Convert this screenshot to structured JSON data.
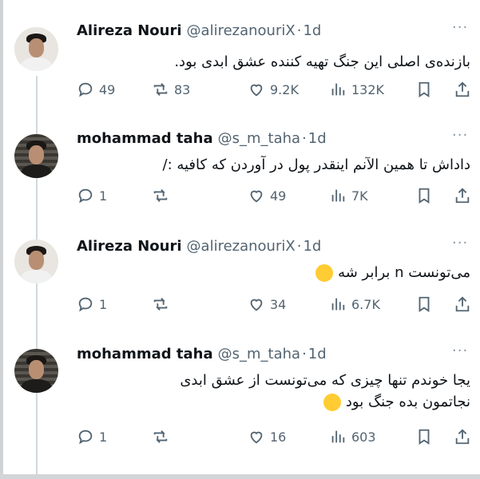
{
  "tweets": [
    {
      "author": "Alireza Nouri",
      "handle": "@alirezanouriX",
      "time": "1d",
      "text_lines": [
        "بازنده‌ی اصلی این جنگ تهیه کننده عشق ابدی بود."
      ],
      "stats": {
        "replies": "49",
        "reposts": "83",
        "likes": "9.2K",
        "views": "132K"
      }
    },
    {
      "author": "mohammad taha",
      "handle": "@s_m_taha",
      "time": "1d",
      "text_lines": [
        "داداش تا همین الآنم اینقدر پول در آوردن که کافیه :/"
      ],
      "stats": {
        "replies": "1",
        "reposts": "",
        "likes": "49",
        "views": "7K"
      }
    },
    {
      "author": "Alireza Nouri",
      "handle": "@alirezanouriX",
      "time": "1d",
      "text_lines": [
        "می‌تونست n برابر شه"
      ],
      "stats": {
        "replies": "1",
        "reposts": "",
        "likes": "34",
        "views": "6.7K"
      }
    },
    {
      "author": "mohammad taha",
      "handle": "@s_m_taha",
      "time": "1d",
      "text_lines": [
        "یجا خوندم تنها چیزی که می‌تونست از عشق ابدی",
        "نجاتمون بده جنگ بود"
      ],
      "stats": {
        "replies": "1",
        "reposts": "",
        "likes": "16",
        "views": "603"
      }
    }
  ],
  "ui": {
    "dot": "·",
    "more": "···"
  },
  "icons": [
    "reply-icon",
    "repost-icon",
    "like-icon",
    "views-icon",
    "bookmark-icon",
    "share-icon",
    "laughing-emoji",
    "more-icon"
  ],
  "colors": {
    "text": "#0f1419",
    "secondary": "#536471",
    "thread_line": "#cfd9de",
    "emoji": "#ffcc33"
  }
}
